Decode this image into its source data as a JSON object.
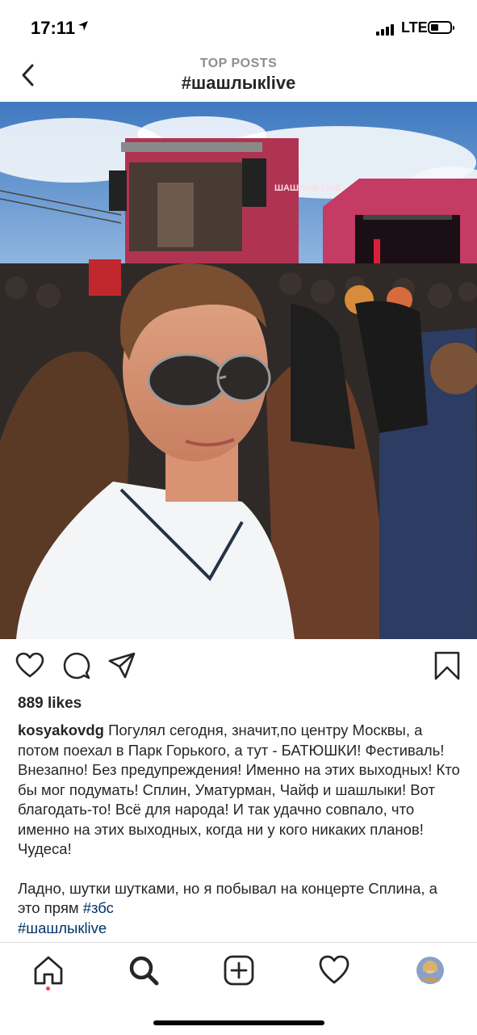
{
  "status_bar": {
    "time": "17:11",
    "network": "LTE"
  },
  "header": {
    "subtitle": "TOP POSTS",
    "title": "#шашлыкlive"
  },
  "post": {
    "likes": "889 likes",
    "username": "kosyakovdg",
    "caption_text": " Погулял сегодня, значит,по центру Москвы, а потом поехал в Парк Горького, а тут - БАТЮШКИ! Фестиваль! Внезапно! Без предупреждения! Именно на этих выходных! Кто бы мог подумать! Сплин, Уматурман, Чайф и шашлыки! Вот благодать-то! Всё для народа! И так удачно совпало, что именно на этих выходных, когда ни у кого никаких планов! Чудеса!",
    "caption_text2": "Ладно, шутки шутками, но я побывал на концерте Сплина, а это прям ",
    "hashtag1": "#збс",
    "hashtag2": "#шашлыкlive",
    "screen_text": "ШАШЛЫК LIVE"
  },
  "icons": {
    "back": "chevron-left-icon",
    "like": "heart-icon",
    "comment": "comment-icon",
    "share": "paper-plane-icon",
    "save": "bookmark-icon",
    "home": "home-icon",
    "search": "search-icon",
    "add": "plus-square-icon",
    "activity": "heart-icon",
    "profile": "avatar"
  },
  "colors": {
    "hashtag": "#003569",
    "accent_dot": "#ed4956",
    "stage": "#c23a5a",
    "sky": "#4f86c6"
  }
}
